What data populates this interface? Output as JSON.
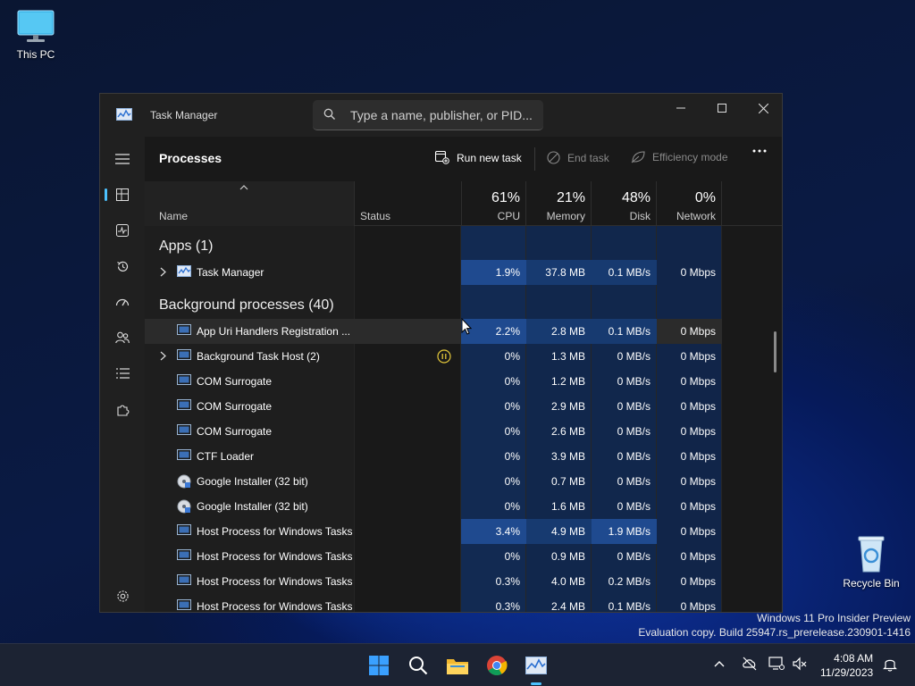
{
  "desktop": {
    "this_pc_label": "This PC",
    "recycle_label": "Recycle Bin",
    "watermark_line1": "Windows 11 Pro Insider Preview",
    "watermark_line2": "Evaluation copy. Build 25947.rs_prerelease.230901-1416"
  },
  "window": {
    "title": "Task Manager",
    "search_placeholder": "Type a name, publisher, or PID..."
  },
  "toolbar": {
    "page_title": "Processes",
    "run_new_task": "Run new task",
    "end_task": "End task",
    "efficiency_mode": "Efficiency mode"
  },
  "columns": {
    "name": "Name",
    "status": "Status",
    "cpu_pct": "61%",
    "cpu": "CPU",
    "memory_pct": "21%",
    "memory": "Memory",
    "disk_pct": "48%",
    "disk": "Disk",
    "network_pct": "0%",
    "network": "Network"
  },
  "groups": {
    "apps": "Apps (1)",
    "background": "Background processes (40)"
  },
  "apps": [
    {
      "name": "Task Manager",
      "cpu": "1.9%",
      "memory": "37.8 MB",
      "disk": "0.1 MB/s",
      "network": "0 Mbps"
    }
  ],
  "background": [
    {
      "name": "App Uri Handlers Registration ...",
      "cpu": "2.2%",
      "memory": "2.8 MB",
      "disk": "0.1 MB/s",
      "network": "0 Mbps"
    },
    {
      "name": "Background Task Host (2)",
      "cpu": "0%",
      "memory": "1.3 MB",
      "disk": "0 MB/s",
      "network": "0 Mbps"
    },
    {
      "name": "COM Surrogate",
      "cpu": "0%",
      "memory": "1.2 MB",
      "disk": "0 MB/s",
      "network": "0 Mbps"
    },
    {
      "name": "COM Surrogate",
      "cpu": "0%",
      "memory": "2.9 MB",
      "disk": "0 MB/s",
      "network": "0 Mbps"
    },
    {
      "name": "COM Surrogate",
      "cpu": "0%",
      "memory": "2.6 MB",
      "disk": "0 MB/s",
      "network": "0 Mbps"
    },
    {
      "name": "CTF Loader",
      "cpu": "0%",
      "memory": "3.9 MB",
      "disk": "0 MB/s",
      "network": "0 Mbps"
    },
    {
      "name": "Google Installer (32 bit)",
      "cpu": "0%",
      "memory": "0.7 MB",
      "disk": "0 MB/s",
      "network": "0 Mbps"
    },
    {
      "name": "Google Installer (32 bit)",
      "cpu": "0%",
      "memory": "1.6 MB",
      "disk": "0 MB/s",
      "network": "0 Mbps"
    },
    {
      "name": "Host Process for Windows Tasks",
      "cpu": "3.4%",
      "memory": "4.9 MB",
      "disk": "1.9 MB/s",
      "network": "0 Mbps"
    },
    {
      "name": "Host Process for Windows Tasks",
      "cpu": "0%",
      "memory": "0.9 MB",
      "disk": "0 MB/s",
      "network": "0 Mbps"
    },
    {
      "name": "Host Process for Windows Tasks",
      "cpu": "0.3%",
      "memory": "4.0 MB",
      "disk": "0.2 MB/s",
      "network": "0 Mbps"
    },
    {
      "name": "Host Process for Windows Tasks",
      "cpu": "0.3%",
      "memory": "2.4 MB",
      "disk": "0.1 MB/s",
      "network": "0 Mbps"
    }
  ],
  "taskbar": {
    "time": "4:08 AM",
    "date": "11/29/2023"
  },
  "colors": {
    "accent": "#4cc2ff",
    "heat_high": "#1f4a8f",
    "heat_mid": "#173a70",
    "heat_low": "#122a52",
    "status_warning": "#e3c73a"
  }
}
